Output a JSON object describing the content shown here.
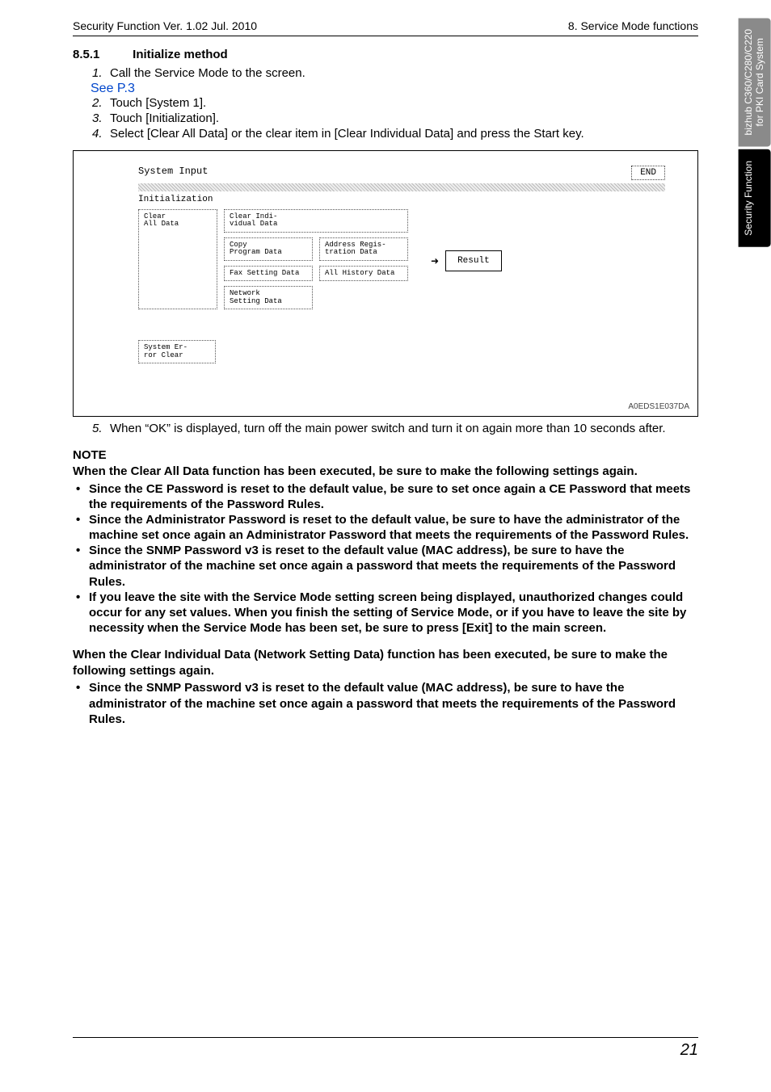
{
  "header": {
    "left": "Security Function Ver. 1.02 Jul. 2010",
    "right": "8. Service Mode functions"
  },
  "section": {
    "number": "8.5.1",
    "title": "Initialize method"
  },
  "steps": [
    {
      "n": "1.",
      "t": "Call the Service Mode to the screen.",
      "link": "See P.3"
    },
    {
      "n": "2.",
      "t": "Touch [System 1]."
    },
    {
      "n": "3.",
      "t": "Touch [Initialization]."
    },
    {
      "n": "4.",
      "t": "Select [Clear All Data] or the clear item in [Clear Individual Data] and press the Start key."
    }
  ],
  "figure": {
    "system_input": "System Input",
    "end": "END",
    "initialization": "Initialization",
    "clear_all": "Clear\nAll Data",
    "clear_indiv": "Clear Indi-\nvidual Data",
    "copy_prog": "Copy\nProgram Data",
    "addr_reg": "Address Regis-\ntration Data",
    "fax_set": "Fax Setting Data",
    "all_hist": "All History Data",
    "net_set": "Network\nSetting Data",
    "sys_err": "System Er-\nror Clear",
    "result": "Result",
    "code": "A0EDS1E037DA"
  },
  "step5": {
    "n": "5.",
    "t": "When “OK” is displayed, turn off the main power switch and turn it on again more than 10 seconds after."
  },
  "note": {
    "head": "NOTE",
    "lead1": "When the Clear All Data function has been executed, be sure to make the following settings again.",
    "bullets1": [
      "Since the CE Password is reset to the default value, be sure to set once again a CE Password that meets the requirements of the Password Rules.",
      "Since the Administrator Password is reset to the default value, be sure to have the administrator of the machine set once again an Administrator Password that meets the requirements of the Password Rules.",
      "Since the SNMP Password v3 is reset to the default value (MAC address), be sure to have the administrator of the machine set once again a password that meets the requirements of the Password Rules.",
      "If you leave the site with the Service Mode setting screen being displayed, unauthorized changes could occur for any set values. When you finish the setting of Service Mode, or if you have to leave the site by necessity when the Service Mode has been set, be sure to press [Exit] to the main screen."
    ],
    "lead2": "When the Clear Individual Data (Network Setting Data) function has been executed, be sure to make the following settings again.",
    "bullets2": [
      "Since the SNMP Password v3 is reset to the default value (MAC address), be sure to have the administrator of the machine set once again a password that meets the requirements of the Password Rules."
    ]
  },
  "tabs": {
    "grey": "bizhub C360/C280/C220\nfor PKI Card System",
    "black": "Security Function"
  },
  "footer": {
    "page": "21"
  }
}
